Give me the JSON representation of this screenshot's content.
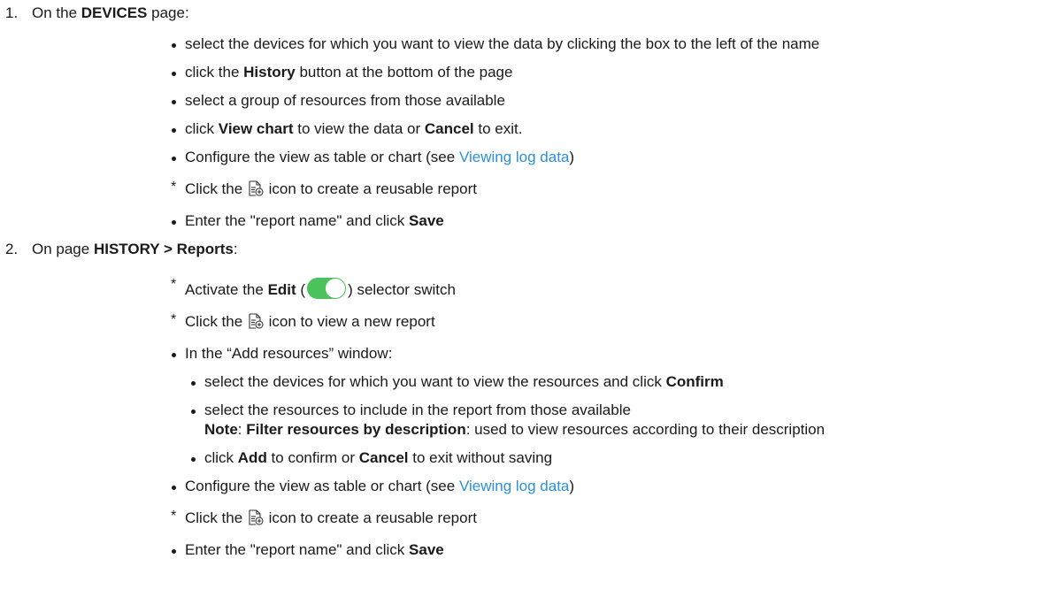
{
  "step1": {
    "number": "1.",
    "intro": "On the ",
    "page": "DEVICES",
    "suffix": " page:",
    "bullets": {
      "b1": "select the devices for which you want to view the data by clicking the box to the left of the name",
      "b2_pre": "click the ",
      "b2_bold": "History",
      "b2_post": " button at the bottom of the page",
      "b3": "select a group of resources from those available",
      "b4_pre": "click ",
      "b4_bold1": "View chart",
      "b4_mid": " to view the data or ",
      "b4_bold2": "Cancel",
      "b4_post": " to exit.",
      "b5_pre": "Configure the view as table or chart (see ",
      "b5_link": "Viewing log data",
      "b5_post": ")",
      "b6_pre": "Click the ",
      "b6_post": " icon to create a reusable report",
      "b7_pre": "Enter the \"report name\" and click ",
      "b7_bold": "Save"
    }
  },
  "step2": {
    "number": "2.",
    "intro": "On page ",
    "page": "HISTORY > Reports",
    "suffix": ":",
    "bullets": {
      "b1_pre": "Activate the ",
      "b1_bold": "Edit",
      "b1_open": " (",
      "b1_close": ") selector switch",
      "b2_pre": "Click the ",
      "b2_post": " icon to view a new report",
      "b3": "In the “Add resources” window:",
      "sub1_pre": "select the devices for which you want to view the resources and click ",
      "sub1_bold": "Confirm",
      "sub2_line1": "select the resources to include in the report from those available",
      "sub2_note": "Note",
      "sub2_colon": ": ",
      "sub2_filter": "Filter resources by description",
      "sub2_post": ": used to view resources according to their description",
      "sub3_pre": "click ",
      "sub3_bold1": "Add",
      "sub3_mid": " to confirm or ",
      "sub3_bold2": "Cancel",
      "sub3_post": " to exit without saving",
      "b4_pre": "Configure the view as table or chart (see ",
      "b4_link": "Viewing log data",
      "b4_post": ")",
      "b5_pre": "Click the ",
      "b5_post": " icon to create a reusable report",
      "b6_pre": "Enter the \"report name\" and click ",
      "b6_bold": "Save"
    }
  },
  "icons": {
    "report": "report-add-icon",
    "toggle": "edit-toggle-switch"
  },
  "colors": {
    "link": "#2a8fdd",
    "toggle_on": "#4cc25c"
  }
}
